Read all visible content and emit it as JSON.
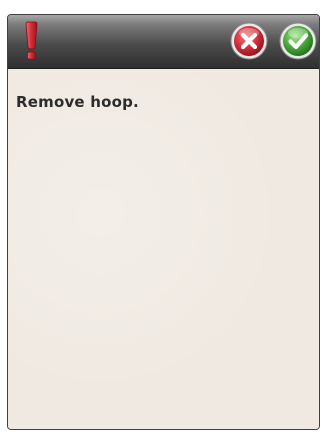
{
  "dialog": {
    "title_icon": "exclamation-icon",
    "cancel_icon": "close-icon",
    "confirm_icon": "checkmark-icon",
    "message": "Remove hoop."
  },
  "colors": {
    "titlebar": "#3a3a3a",
    "background": "#efe9e1",
    "warning": "#c8242f",
    "cancel": "#c4262e",
    "confirm": "#4aa839",
    "text": "#2c2c2c"
  }
}
